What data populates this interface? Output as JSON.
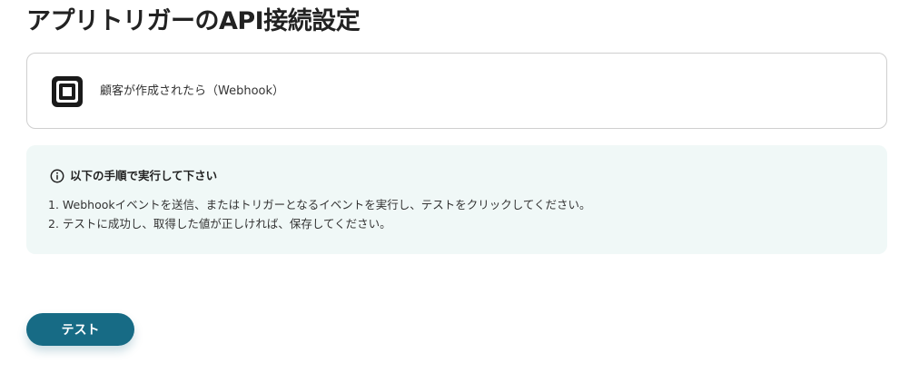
{
  "page": {
    "title": "アプリトリガーのAPI接続設定"
  },
  "trigger": {
    "app_icon": "square-logo-icon",
    "label": "顧客が作成されたら（Webhook）"
  },
  "instructions": {
    "icon": "info-icon",
    "heading": "以下の手順で実行して下さい",
    "steps": [
      "1. Webhookイベントを送信、またはトリガーとなるイベントを実行し、テストをクリックしてください。",
      "2. テストに成功し、取得した値が正しければ、保存してください。"
    ]
  },
  "actions": {
    "test_label": "テスト"
  },
  "colors": {
    "button": "#176b85",
    "info_background": "#f0f8f7",
    "card_border": "#cfcfcf"
  }
}
